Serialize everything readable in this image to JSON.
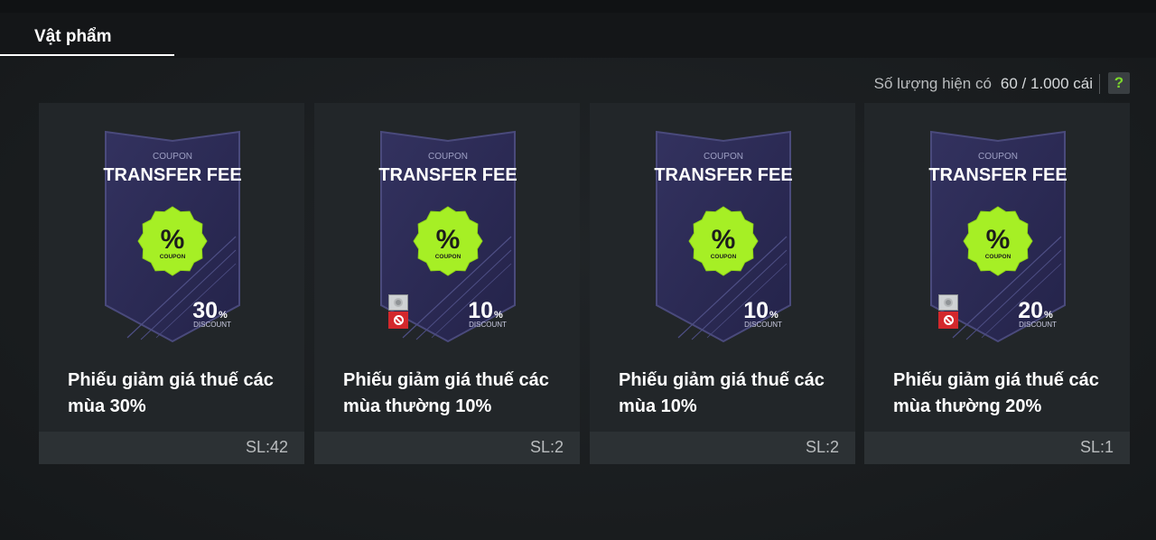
{
  "tab": {
    "label": "Vật phẩm"
  },
  "stock": {
    "label": "Số lượng hiện có",
    "value": "60 / 1.000 cái",
    "help": "?"
  },
  "colors": {
    "accent_green": "#7bd82b",
    "card_bg": "#222629",
    "coupon_bg": "#2b2a55",
    "restricted_red": "#d3282c"
  },
  "cards": [
    {
      "coupon_small": "COUPON",
      "coupon_title": "TRANSFER FEE",
      "badge_symbol": "%",
      "badge_text": "COUPON",
      "percent": "30",
      "percent_sign": "%",
      "discount": "DISCOUNT",
      "name": "Phiếu giảm giá thuế các mùa 30%",
      "qty": "SL:42",
      "restricted": false
    },
    {
      "coupon_small": "COUPON",
      "coupon_title": "TRANSFER FEE",
      "badge_symbol": "%",
      "badge_text": "COUPON",
      "percent": "10",
      "percent_sign": "%",
      "discount": "DISCOUNT",
      "name": "Phiếu giảm giá thuế các mùa thường 10%",
      "qty": "SL:2",
      "restricted": true
    },
    {
      "coupon_small": "COUPON",
      "coupon_title": "TRANSFER FEE",
      "badge_symbol": "%",
      "badge_text": "COUPON",
      "percent": "10",
      "percent_sign": "%",
      "discount": "DISCOUNT",
      "name": "Phiếu giảm giá thuế các mùa 10%",
      "qty": "SL:2",
      "restricted": false
    },
    {
      "coupon_small": "COUPON",
      "coupon_title": "TRANSFER FEE",
      "badge_symbol": "%",
      "badge_text": "COUPON",
      "percent": "20",
      "percent_sign": "%",
      "discount": "DISCOUNT",
      "name": "Phiếu giảm giá thuế các mùa thường 20%",
      "qty": "SL:1",
      "restricted": true
    }
  ]
}
